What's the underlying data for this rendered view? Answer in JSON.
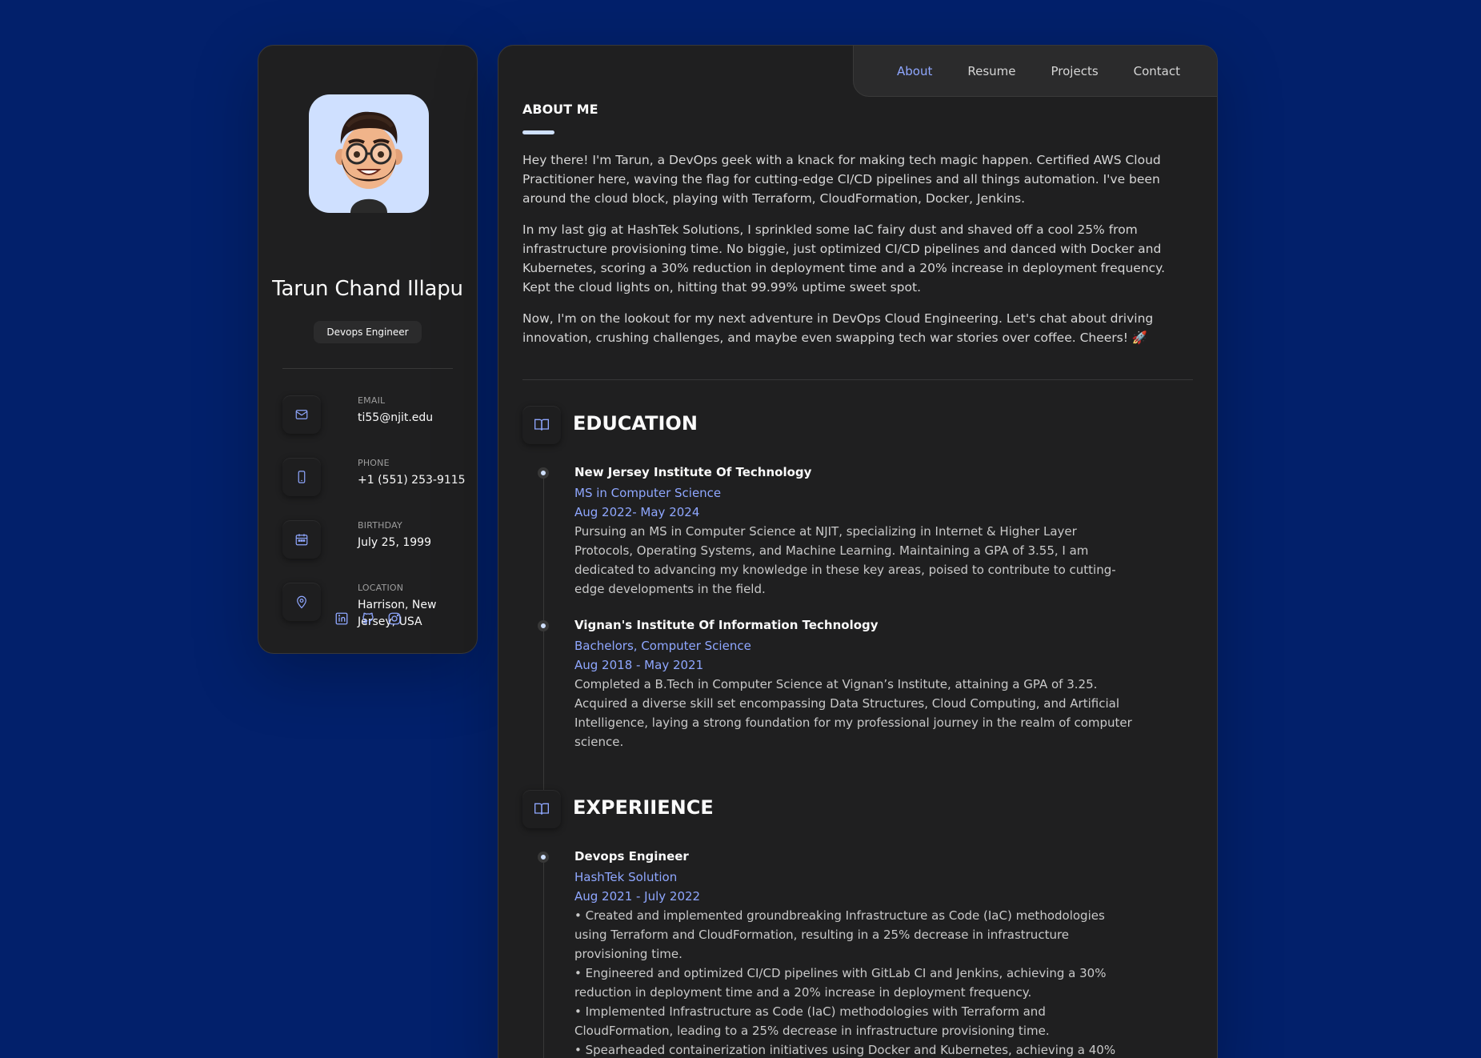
{
  "profile": {
    "name": "Tarun Chand Illapu",
    "title": "Devops Engineer"
  },
  "contacts": [
    {
      "label": "EMAIL",
      "value": "ti55@njit.edu",
      "icon": "mail-icon"
    },
    {
      "label": "PHONE",
      "value": "+1 (551) 253-9115",
      "icon": "phone-icon"
    },
    {
      "label": "BIRTHDAY",
      "value": "July 25, 1999",
      "icon": "calendar-icon"
    },
    {
      "label": "LOCATION",
      "value": "Harrison, New Jersey, USA",
      "icon": "location-icon"
    }
  ],
  "socials": [
    "linkedin-icon",
    "github-icon",
    "instagram-icon"
  ],
  "nav": [
    {
      "label": "About",
      "active": true
    },
    {
      "label": "Resume",
      "active": false
    },
    {
      "label": "Projects",
      "active": false
    },
    {
      "label": "Contact",
      "active": false
    }
  ],
  "about": {
    "heading": "ABOUT ME",
    "paragraphs": [
      "Hey there! I'm Tarun, a DevOps geek with a knack for making tech magic happen. Certified AWS Cloud Practitioner here, waving the flag for cutting-edge CI/CD pipelines and all things automation. I've been around the cloud block, playing with Terraform, CloudFormation, Docker, Jenkins.",
      "In my last gig at HashTek Solutions, I sprinkled some IaC fairy dust and shaved off a cool 25% from infrastructure provisioning time. No biggie, just optimized CI/CD pipelines and danced with Docker and Kubernetes, scoring a 30% reduction in deployment time and a 20% increase in deployment frequency. Kept the cloud lights on, hitting that 99.99% uptime sweet spot.",
      "Now, I'm on the lookout for my next adventure in DevOps Cloud Engineering. Let's chat about driving innovation, crushing challenges, and maybe even swapping tech war stories over coffee. Cheers! 🚀"
    ]
  },
  "education": {
    "heading": "EDUCATION",
    "items": [
      {
        "title": "New Jersey Institute Of Technology",
        "subtitle": "MS in Computer Science",
        "date": "Aug 2022- May 2024",
        "text": "Pursuing an MS in Computer Science at NJIT, specializing in Internet & Higher Layer Protocols, Operating Systems, and Machine Learning. Maintaining a GPA of 3.55, I am dedicated to advancing my knowledge in these key areas, poised to contribute to cutting-edge developments in the field."
      },
      {
        "title": "Vignan's Institute Of Information Technology",
        "subtitle": "Bachelors, Computer Science",
        "date": "Aug 2018 - May 2021",
        "text": "Completed a B.Tech in Computer Science at Vignan’s Institute, attaining a GPA of 3.25. Acquired a diverse skill set encompassing Data Structures, Cloud Computing, and Artificial Intelligence, laying a strong foundation for my professional journey in the realm of computer science."
      }
    ]
  },
  "experience": {
    "heading": "EXPERIIENCE",
    "items": [
      {
        "title": "Devops Engineer",
        "subtitle": "HashTek Solution",
        "date": "Aug 2021 - July 2022",
        "bullets": [
          "• Created and implemented groundbreaking Infrastructure as Code (IaC) methodologies using Terraform and CloudFormation, resulting in a 25% decrease in infrastructure provisioning time.",
          "• Engineered and optimized CI/CD pipelines with GitLab CI and Jenkins, achieving a 30% reduction in deployment time and a 20% increase in deployment frequency.",
          "• Implemented Infrastructure as Code (IaC) methodologies with Terraform and CloudFormation, leading to a 25% decrease in infrastructure provisioning time.",
          "• Spearheaded containerization initiatives using Docker and Kubernetes, achieving a 40%"
        ]
      }
    ]
  }
}
